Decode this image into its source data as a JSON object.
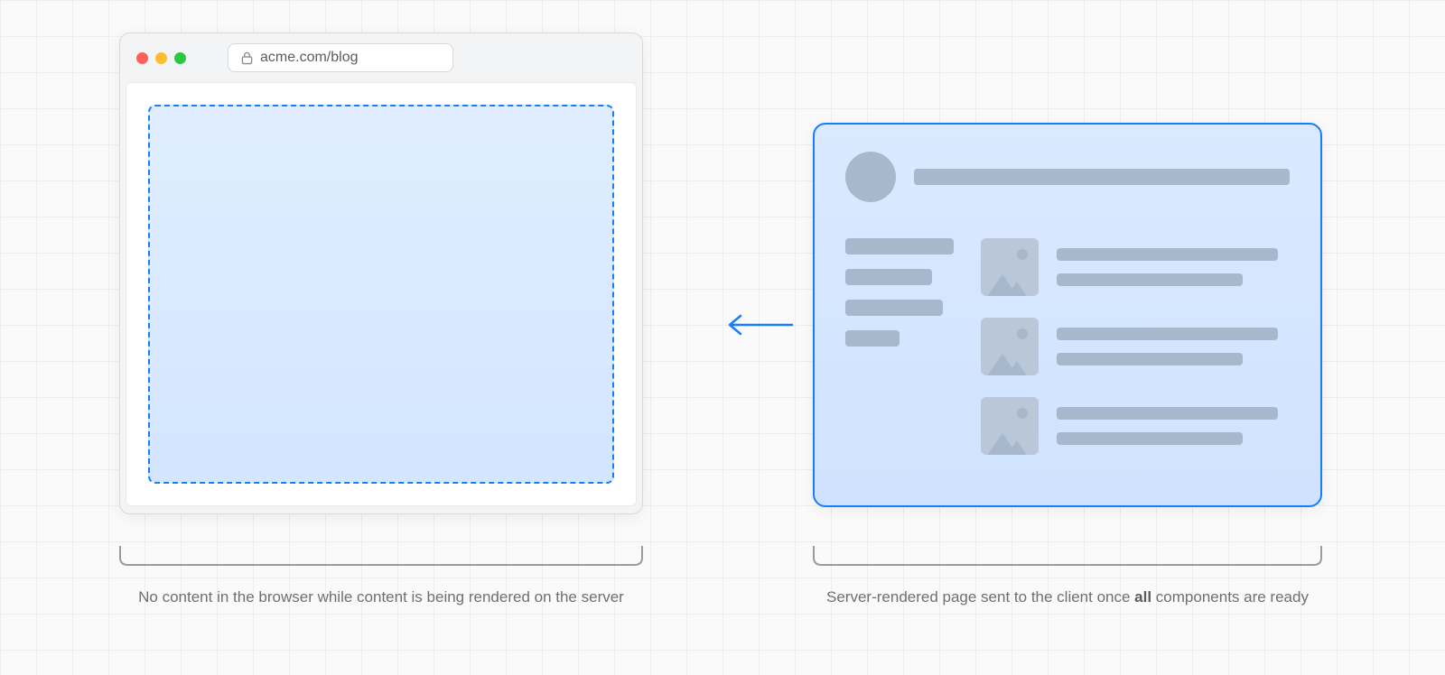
{
  "browser": {
    "url": "acme.com/blog"
  },
  "captions": {
    "left": "No content in the browser while content is being rendered on the server",
    "right_pre": "Server-rendered page sent to the client once ",
    "right_bold": "all",
    "right_post": " components are ready"
  },
  "colors": {
    "accent": "#167dff",
    "skeleton": "#a7b7cc",
    "card_bg_top": "#dbe9ff",
    "card_bg_bottom": "#cfe2ff"
  }
}
